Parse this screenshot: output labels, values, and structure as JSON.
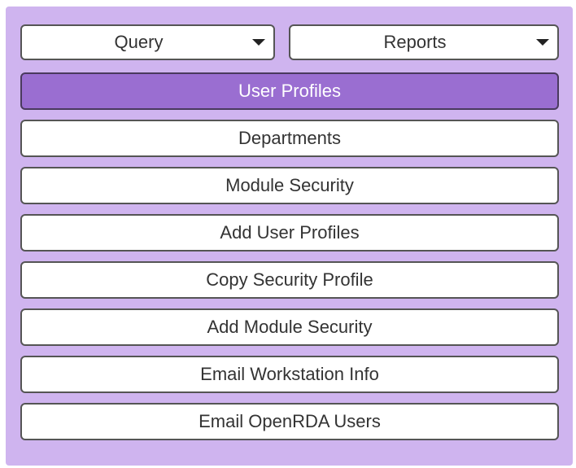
{
  "colors": {
    "panel_bg": "#cfb4ef",
    "active_bg": "#9a6ed1",
    "button_bg": "#ffffff",
    "text": "#333333",
    "active_text": "#ffffff"
  },
  "dropdowns": {
    "query": {
      "label": "Query",
      "icon": "caret-down-icon"
    },
    "reports": {
      "label": "Reports",
      "icon": "caret-down-icon"
    }
  },
  "menu": {
    "items": [
      {
        "label": "User Profiles",
        "active": true
      },
      {
        "label": "Departments",
        "active": false
      },
      {
        "label": "Module Security",
        "active": false
      },
      {
        "label": "Add User Profiles",
        "active": false
      },
      {
        "label": "Copy Security Profile",
        "active": false
      },
      {
        "label": "Add Module Security",
        "active": false
      },
      {
        "label": "Email Workstation Info",
        "active": false
      },
      {
        "label": "Email OpenRDA Users",
        "active": false
      }
    ]
  }
}
